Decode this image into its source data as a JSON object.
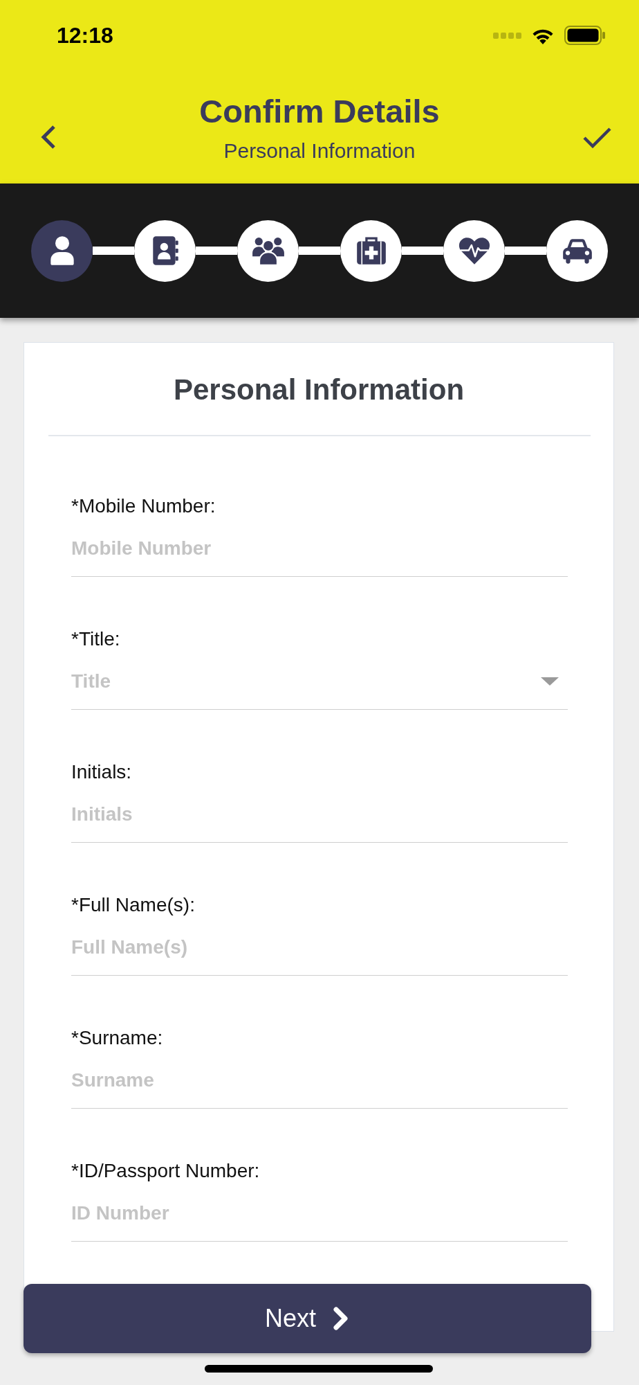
{
  "status_bar": {
    "time": "12:18"
  },
  "header": {
    "title": "Confirm Details",
    "subtitle": "Personal Information"
  },
  "steps": [
    {
      "kind": "personal",
      "selected": true
    },
    {
      "kind": "contact",
      "selected": false
    },
    {
      "kind": "family",
      "selected": false
    },
    {
      "kind": "medical",
      "selected": false
    },
    {
      "kind": "health",
      "selected": false
    },
    {
      "kind": "vehicle",
      "selected": false
    }
  ],
  "form": {
    "heading": "Personal Information",
    "fields": [
      {
        "kind": "text",
        "label": "*Mobile Number:",
        "placeholder": "Mobile Number"
      },
      {
        "kind": "select",
        "label": "*Title:",
        "placeholder": "Title"
      },
      {
        "kind": "text",
        "label": "Initials:",
        "placeholder": "Initials"
      },
      {
        "kind": "text",
        "label": "*Full Name(s):",
        "placeholder": "Full Name(s)"
      },
      {
        "kind": "text",
        "label": "*Surname:",
        "placeholder": "Surname"
      },
      {
        "kind": "text",
        "label": "*ID/Passport Number:",
        "placeholder": "ID Number"
      }
    ]
  },
  "next_button": {
    "label": "Next"
  }
}
